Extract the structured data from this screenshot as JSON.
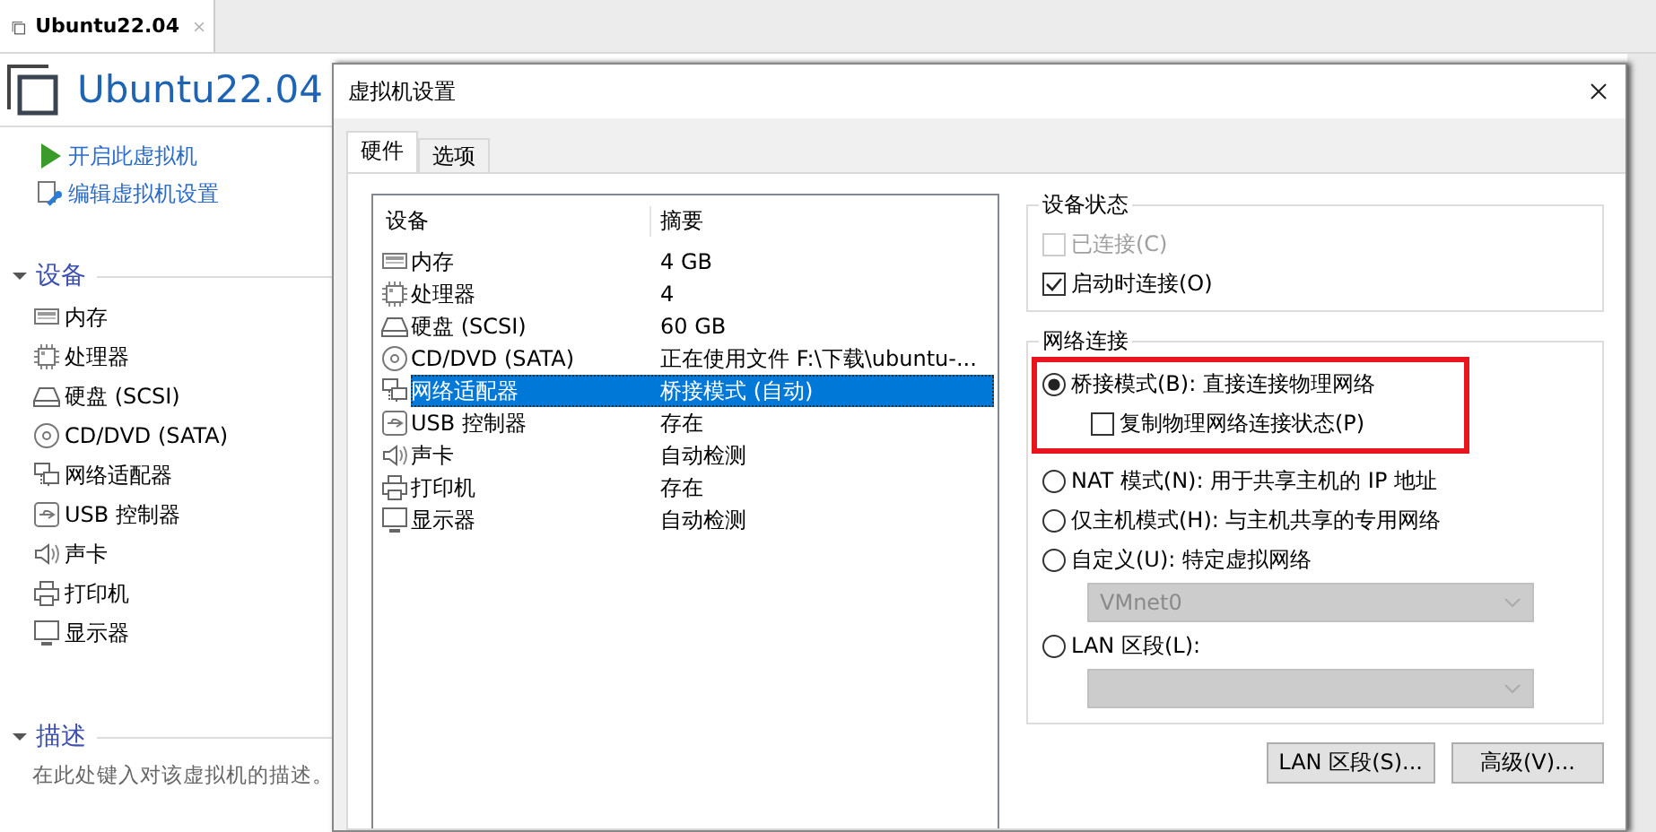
{
  "app_tab": {
    "title": "Ubuntu22.04",
    "selected": true
  },
  "vm": {
    "name": "Ubuntu22.04",
    "actions": [
      {
        "kind": "power",
        "label": "开启此虚拟机"
      },
      {
        "kind": "edit",
        "label": "编辑虚拟机设置"
      }
    ],
    "devices_section": {
      "title": "设备",
      "expanded": true,
      "devices": [
        {
          "kind": "memory",
          "label": "内存"
        },
        {
          "kind": "cpu",
          "label": "处理器"
        },
        {
          "kind": "disk",
          "label": "硬盘 (SCSI)"
        },
        {
          "kind": "cd",
          "label": "CD/DVD (SATA)"
        },
        {
          "kind": "network",
          "label": "网络适配器"
        },
        {
          "kind": "usb",
          "label": "USB 控制器"
        },
        {
          "kind": "sound",
          "label": "声卡"
        },
        {
          "kind": "printer",
          "label": "打印机"
        },
        {
          "kind": "display",
          "label": "显示器"
        }
      ]
    },
    "description_section": {
      "title": "描述",
      "expanded": true,
      "placeholder": "在此处键入对该虚拟机的描述。"
    }
  },
  "dialog": {
    "title": "虚拟机设置",
    "tabs": [
      {
        "label": "硬件",
        "selected": true
      },
      {
        "label": "选项",
        "selected": false
      }
    ],
    "device_table": {
      "columns": [
        "设备",
        "摘要"
      ],
      "rows": [
        {
          "kind": "memory",
          "device": "内存",
          "summary": "4 GB",
          "selected": false
        },
        {
          "kind": "cpu",
          "device": "处理器",
          "summary": "4",
          "selected": false
        },
        {
          "kind": "disk",
          "device": "硬盘 (SCSI)",
          "summary": "60 GB",
          "selected": false
        },
        {
          "kind": "cd",
          "device": "CD/DVD (SATA)",
          "summary": "正在使用文件 F:\\下载\\ubuntu-...",
          "selected": false
        },
        {
          "kind": "network",
          "device": "网络适配器",
          "summary": "桥接模式 (自动)",
          "selected": true
        },
        {
          "kind": "usb",
          "device": "USB 控制器",
          "summary": "存在",
          "selected": false
        },
        {
          "kind": "sound",
          "device": "声卡",
          "summary": "自动检测",
          "selected": false
        },
        {
          "kind": "printer",
          "device": "打印机",
          "summary": "存在",
          "selected": false
        },
        {
          "kind": "display",
          "device": "显示器",
          "summary": "自动检测",
          "selected": false
        }
      ]
    },
    "device_status": {
      "title": "设备状态",
      "options": [
        {
          "label": "已连接(C)",
          "checked": false,
          "disabled": true
        },
        {
          "label": "启动时连接(O)",
          "checked": true,
          "disabled": false
        }
      ]
    },
    "network": {
      "title": "网络连接",
      "options": [
        {
          "kind": "radio",
          "label": "桥接模式(B): 直接连接物理网络",
          "selected": true,
          "highlighted": true
        },
        {
          "kind": "checkbox",
          "label": "复制物理网络连接状态(P)",
          "checked": false,
          "highlighted": true
        },
        {
          "kind": "radio",
          "label": "NAT 模式(N): 用于共享主机的 IP 地址",
          "selected": false,
          "highlighted": false
        },
        {
          "kind": "radio",
          "label": "仅主机模式(H): 与主机共享的专用网络",
          "selected": false,
          "highlighted": false
        },
        {
          "kind": "radio",
          "label": "自定义(U): 特定虚拟网络",
          "selected": false,
          "highlighted": false
        },
        {
          "kind": "dropdown",
          "value": "VMnet0",
          "disabled": true,
          "highlighted": false
        },
        {
          "kind": "radio",
          "label": "LAN 区段(L):",
          "selected": false,
          "highlighted": false
        },
        {
          "kind": "dropdown",
          "disabled": true,
          "highlighted": false
        }
      ]
    },
    "buttons": [
      "LAN 区段(S)...",
      "高级(V)..."
    ]
  }
}
